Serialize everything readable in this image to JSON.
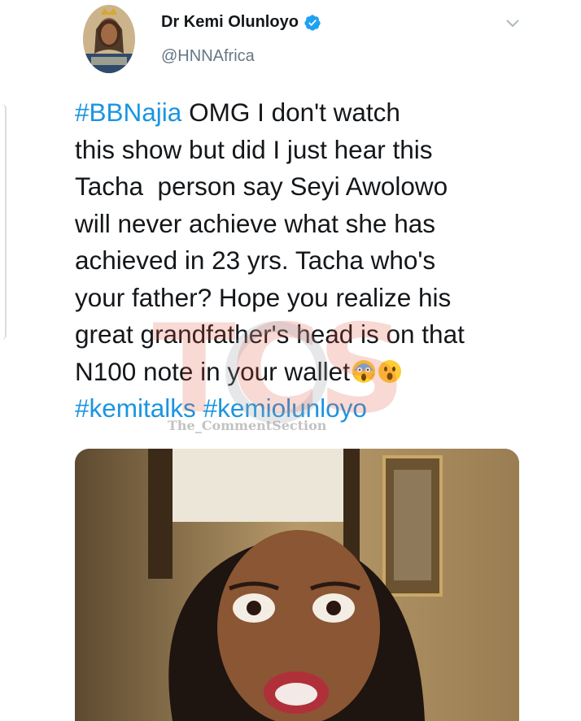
{
  "tweet": {
    "display_name": "Dr Kemi Olunloyo",
    "handle": "@HNNAfrica",
    "verified_icon": "verified-badge-icon",
    "menu_icon": "chevron-down-icon",
    "hashtag_lead": "#BBNajia",
    "body_line1": " OMG I don't watch",
    "body_line2": "this show but did I just hear this",
    "body_line3": "Tacha  person say Seyi Awolowo",
    "body_line4": "will never achieve what she has",
    "body_line5": "achieved in 23 yrs. Tacha who's",
    "body_line6": "your father? Hope you realize his",
    "body_line7": "great grandfather's head is on that",
    "body_line8": "N100 note in your wallet",
    "hashtag1": "#kemitalks",
    "hashtag2": "#kemiolunloyo",
    "emojis": [
      "face-screaming-in-fear",
      "astonished-face"
    ]
  },
  "watermark": {
    "logo_text": "TCS",
    "caption": "The_CommentSection"
  },
  "colors": {
    "link": "#1b95e0",
    "verified": "#1da1f2",
    "secondary_text": "#657786"
  }
}
